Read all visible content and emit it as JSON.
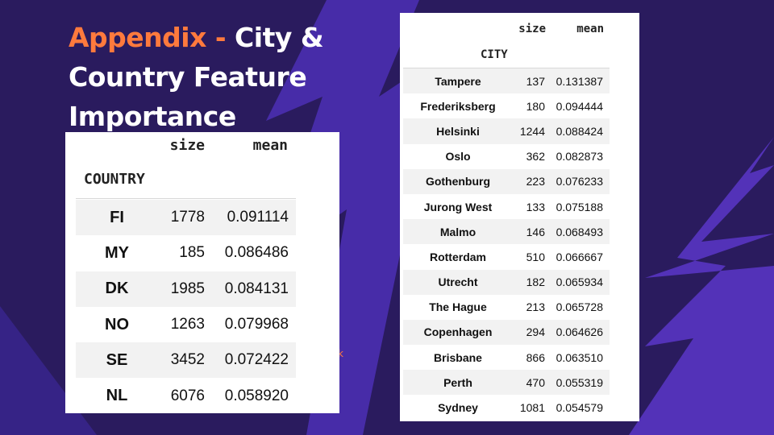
{
  "colors": {
    "background": "#2a1b5e",
    "accent": "#ff7a3d",
    "bolt": "#4a2fb0"
  },
  "title": {
    "accent": "Appendix -",
    "main": " City & Country Feature Importance"
  },
  "stray_mark": "k",
  "country_table": {
    "col_size": "size",
    "col_mean": "mean",
    "index_name": "COUNTRY",
    "rows": [
      {
        "key": "FI",
        "size": "1778",
        "mean": "0.091114"
      },
      {
        "key": "MY",
        "size": "185",
        "mean": "0.086486"
      },
      {
        "key": "DK",
        "size": "1985",
        "mean": "0.084131"
      },
      {
        "key": "NO",
        "size": "1263",
        "mean": "0.079968"
      },
      {
        "key": "SE",
        "size": "3452",
        "mean": "0.072422"
      },
      {
        "key": "NL",
        "size": "6076",
        "mean": "0.058920"
      }
    ]
  },
  "city_table": {
    "col_size": "size",
    "col_mean": "mean",
    "index_name": "CITY",
    "rows": [
      {
        "key": "Tampere",
        "size": "137",
        "mean": "0.131387"
      },
      {
        "key": "Frederiksberg",
        "size": "180",
        "mean": "0.094444"
      },
      {
        "key": "Helsinki",
        "size": "1244",
        "mean": "0.088424"
      },
      {
        "key": "Oslo",
        "size": "362",
        "mean": "0.082873"
      },
      {
        "key": "Gothenburg",
        "size": "223",
        "mean": "0.076233"
      },
      {
        "key": "Jurong West",
        "size": "133",
        "mean": "0.075188"
      },
      {
        "key": "Malmo",
        "size": "146",
        "mean": "0.068493"
      },
      {
        "key": "Rotterdam",
        "size": "510",
        "mean": "0.066667"
      },
      {
        "key": "Utrecht",
        "size": "182",
        "mean": "0.065934"
      },
      {
        "key": "The Hague",
        "size": "213",
        "mean": "0.065728"
      },
      {
        "key": "Copenhagen",
        "size": "294",
        "mean": "0.064626"
      },
      {
        "key": "Brisbane",
        "size": "866",
        "mean": "0.063510"
      },
      {
        "key": "Perth",
        "size": "470",
        "mean": "0.055319"
      },
      {
        "key": "Sydney",
        "size": "1081",
        "mean": "0.054579"
      }
    ]
  }
}
